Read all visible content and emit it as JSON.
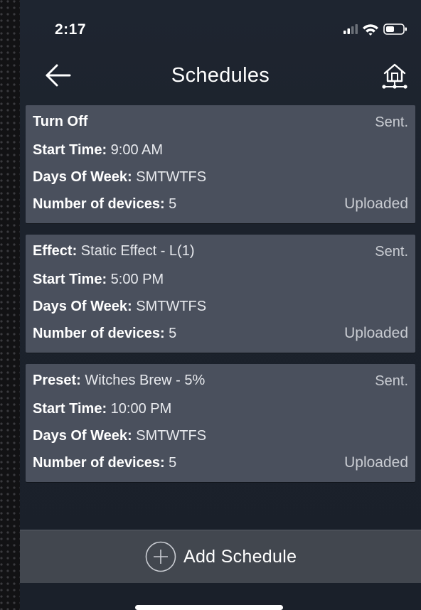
{
  "status_bar": {
    "time": "2:17",
    "icons": [
      "cellular-signal-icon",
      "wifi-icon",
      "battery-icon"
    ]
  },
  "header": {
    "title": "Schedules",
    "back_icon": "arrow-left-icon",
    "home_icon": "home-network-icon"
  },
  "schedules": [
    {
      "name_label": "Turn Off",
      "name_value": "",
      "status": "Sent.",
      "start_label": "Start Time:",
      "start_value": "9:00 AM",
      "days_label": "Days Of Week:",
      "days_value": "SMTWTFS",
      "devices_label": "Number of devices:",
      "devices_value": "5",
      "upload_status": "Uploaded"
    },
    {
      "name_label": "Effect:",
      "name_value": "Static Effect - L(1)",
      "status": "Sent.",
      "start_label": "Start Time:",
      "start_value": "5:00 PM",
      "days_label": "Days Of Week:",
      "days_value": "SMTWTFS",
      "devices_label": "Number of devices:",
      "devices_value": "5",
      "upload_status": "Uploaded"
    },
    {
      "name_label": "Preset:",
      "name_value": "Witches Brew - 5%",
      "status": "Sent.",
      "start_label": "Start Time:",
      "start_value": "10:00 PM",
      "days_label": "Days Of Week:",
      "days_value": "SMTWTFS",
      "devices_label": "Number of devices:",
      "devices_value": "5",
      "upload_status": "Uploaded"
    }
  ],
  "footer": {
    "add_label": "Add Schedule",
    "add_icon": "plus-circle-icon"
  },
  "colors": {
    "background": "#1c222c",
    "card": "#4a505d",
    "footer_bar": "#42474f",
    "text": "#ffffff",
    "muted_text": "#c9ccd2"
  }
}
